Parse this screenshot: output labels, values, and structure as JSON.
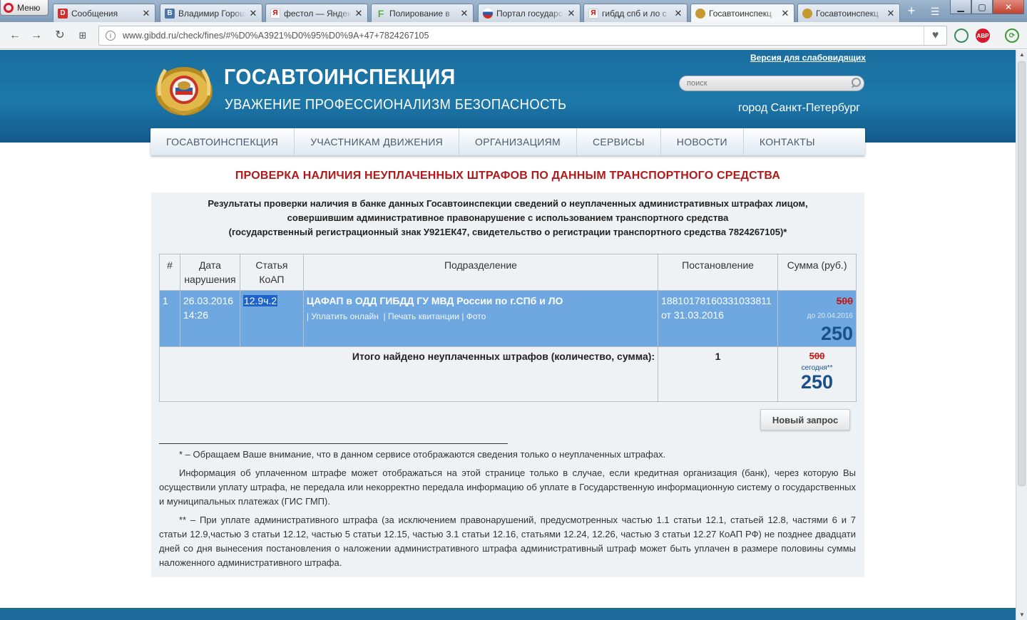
{
  "browser": {
    "menu_label": "Меню",
    "tabs": [
      {
        "label": "Сообщения",
        "icon": "D",
        "color": "#d0312d"
      },
      {
        "label": "Владимир Горош",
        "icon": "B",
        "color": "#4a76a8"
      },
      {
        "label": "фестол — Яндекс",
        "icon": "Я",
        "color": "#e8e8e8"
      },
      {
        "label": "Полирование в",
        "icon": "F",
        "color": "#5bb040"
      },
      {
        "label": "Портал государс",
        "icon": "",
        "color": "#d52b1e"
      },
      {
        "label": "гибдд спб и ло с",
        "icon": "Я",
        "color": "#e8e8e8"
      },
      {
        "label": "Госавтоинспекц",
        "icon": "",
        "color": "#c69a33"
      },
      {
        "label": "Госавтоинспекц",
        "icon": "",
        "color": "#c69a33"
      }
    ],
    "url": "www.gibdd.ru/check/fines/#%D0%A3921%D0%95%D0%9A+47+7824267105",
    "abp_label": "ABP"
  },
  "header": {
    "accessible_link": "Версия для слабовидящих",
    "site_title": "ГОСАВТОИНСПЕКЦИЯ",
    "slogan": "УВАЖЕНИЕ  ПРОФЕССИОНАЛИЗМ  БЕЗОПАСНОСТЬ",
    "search_placeholder": "поиск",
    "city": "город Санкт-Петербург"
  },
  "nav": [
    "ГОСАВТОИНСПЕКЦИЯ",
    "УЧАСТНИКАМ ДВИЖЕНИЯ",
    "ОРГАНИЗАЦИЯМ",
    "СЕРВИСЫ",
    "НОВОСТИ",
    "КОНТАКТЫ"
  ],
  "page": {
    "heading": "ПРОВЕРКА НАЛИЧИЯ НЕУПЛАЧЕННЫХ ШТРАФОВ ПО ДАННЫМ ТРАНСПОРТНОГО СРЕДСТВА",
    "intro_line1": "Результаты проверки наличия в банке данных Госавтоинспекции сведений о неуплаченных административных штрафах лицом,",
    "intro_line2": "совершившим административное правонарушение с использованием транспортного средства",
    "intro_line3": "(государственный регистрационный знак У921ЕК47, свидетельство о регистрации транспортного средства 7824267105)*"
  },
  "table": {
    "headers": {
      "num": "#",
      "date": "Дата нарушения",
      "article": "Статья КоАП",
      "unit": "Подразделение",
      "resolution": "Постановление",
      "sum": "Сумма (руб.)"
    },
    "row": {
      "num": "1",
      "date": "26.03.2016",
      "time": "14:26",
      "article": "12.9ч.2",
      "unit": "ЦАФАП в ОДД ГИБДД ГУ МВД России по г.СПб и ЛО",
      "link_pay": "| Уплатить онлайн",
      "link_print": "| Печать квитанции",
      "link_photo": "| Фото",
      "resolution_number": "18810178160331033811",
      "resolution_date": "от 31.03.2016",
      "old_sum": "500",
      "due_label": "до 20.04.2016",
      "sum": "250"
    },
    "total": {
      "label": "Итого найдено неуплаченных штрафов (количество, сумма):",
      "count": "1",
      "old_sum": "500",
      "today_label": "сегодня**",
      "sum": "250"
    }
  },
  "new_request_label": "Новый запрос",
  "footnotes": {
    "note1": "* – Обращаем Ваше внимание, что в данном сервисе отображаются сведения только о неуплаченных штрафах.",
    "note2": "Информация об уплаченном штрафе может отображаться на этой странице только в случае, если кредитная организация (банк), через которую Вы осуществили уплату штрафа, не передала или некорректно передала информацию об уплате в Государственную информационную систему о государственных и муниципальных платежах (ГИС ГМП).",
    "note3": "** – При уплате административного штрафа (за исключением правонарушений, предусмотренных частью 1.1 статьи 12.1, статьей 12.8, частями 6 и 7 статьи 12.9,частью 3 статьи 12.12, частью 5 статьи 12.15, частью 3.1 статьи 12.16, статьями 12.24, 12.26, частью 3 статьи 12.27 КоАП РФ) не позднее двадцати дней со дня вынесения постановления о наложении административного штрафа административный штраф может быть уплачен в размере половины суммы наложенного административного штрафа."
  },
  "colors": {
    "header_blue": "#1d78aa",
    "heading_red": "#b2191a",
    "row_highlight": "#6fa8e0",
    "sum_blue": "#1a4f8c"
  }
}
